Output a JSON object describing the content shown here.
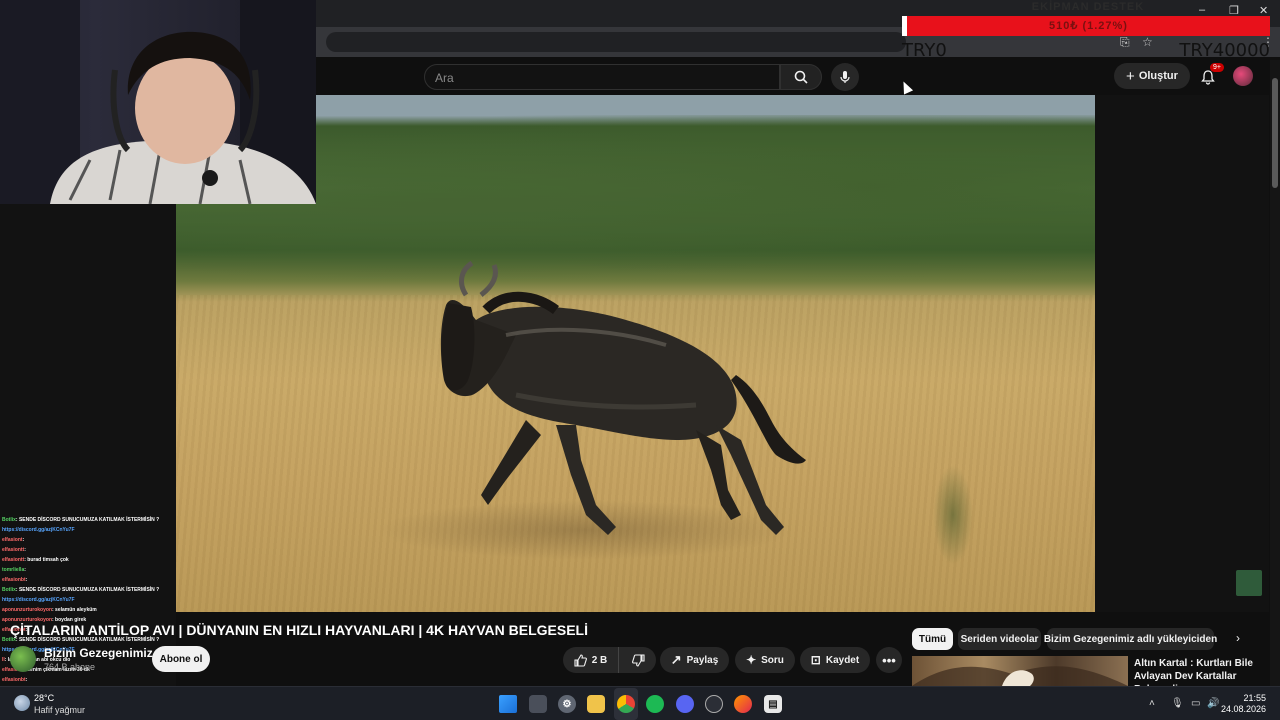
{
  "donation": {
    "title": "EKİPMAN DESTEK",
    "progress_text": "510₺ (1.27%)",
    "progress_fraction": 0.0127,
    "current": "TRY0",
    "goal": "TRY40000"
  },
  "youtube": {
    "search_placeholder": "Ara",
    "create_label": "Oluştur",
    "notification_count": "9+"
  },
  "video": {
    "title": "ÇİTALARIN ANTİLOP AVI | DÜNYANIN EN HIZLI HAYVANLARI | 4K HAYVAN BELGESELİ",
    "channel_name": "Bizim Gezegenimiz",
    "subscribers": "764 B abone",
    "subscribe_label": "Abone ol",
    "like_count": "2 B",
    "share_label": "Paylaş",
    "ask_label": "Soru",
    "save_label": "Kaydet"
  },
  "chips": [
    "Tümü",
    "Seriden videolar",
    "Bizim Gezegenimiz adlı yükleyiciden"
  ],
  "recommendation": {
    "title": "Altın Kartal : Kurtları Bile Avlayan Dev Kartallar Belgeseli"
  },
  "chat": [
    {
      "user": "Botlix",
      "text": ": SENDE DİSCORD SUNUCUMUZA KATILMAK İSTERMİSİN ?",
      "color": "g"
    },
    {
      "user": "",
      "text": "https://discord.gg/azjKCnYu7F",
      "color": "l"
    },
    {
      "user": "elfasiont",
      "text": ":",
      "color": "u"
    },
    {
      "user": "elfasiontt",
      "text": ":",
      "color": "u"
    },
    {
      "user": "elfasiontt",
      "text": ": burad timsah çok",
      "color": "u"
    },
    {
      "user": "tomrliella",
      "text": ":",
      "color": "g"
    },
    {
      "user": "elfasionbt",
      "text": ":",
      "color": "u"
    },
    {
      "user": "Botlix",
      "text": ": SENDE DİSCORD SUNUCUMUZA KATILMAK İSTERMİSİN ?",
      "color": "g"
    },
    {
      "user": "",
      "text": "https://discord.gg/azjKCnYu7F",
      "color": "l"
    },
    {
      "user": "aponunzurturokoyon",
      "text": ": selamün aleyküm",
      "color": "u"
    },
    {
      "user": "aponunzurturokoyon",
      "text": ": boydan girek",
      "color": "u"
    },
    {
      "user": "elfasionbt",
      "text": ":",
      "color": "u"
    },
    {
      "user": "Botlix",
      "text": ": SENDE DİSCORD SUNUCUMUZA KATILMAK İSTERMİSİN ?",
      "color": "g"
    },
    {
      "user": "",
      "text": "https://discord.gg/azjKCnYu7F",
      "color": "l"
    },
    {
      "user": "ll",
      "text": ": lane oğuzhan abi okcu dio",
      "color": "u"
    },
    {
      "user": "elfasionlt",
      "text": ": benim çıkmam lazım 30 dk",
      "color": "u"
    },
    {
      "user": "elfasionbt",
      "text": ":",
      "color": "u"
    }
  ],
  "taskbar": {
    "temperature": "28°C",
    "weather": "Hafif yağmur",
    "time": "21:55",
    "date": "24.08.2026"
  }
}
